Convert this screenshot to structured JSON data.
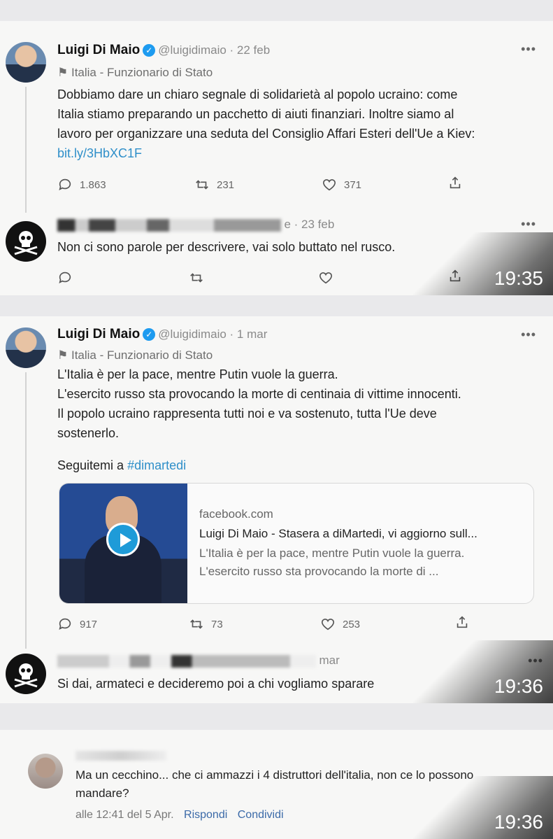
{
  "panel1": {
    "tweet": {
      "name": "Luigi Di Maio",
      "handle": "@luigidimaio · 22 feb",
      "label": "Italia - Funzionario di Stato",
      "text_lines": [
        "Dobbiamo dare un chiaro segnale di solidarietà al popolo ucraino: come",
        "Italia stiamo preparando un pacchetto di aiuti finanziari. Inoltre siamo al",
        "lavoro per organizzare una seduta del Consiglio Affari Esteri dell'Ue a Kiev:"
      ],
      "link": "bit.ly/3HbXC1F",
      "replies": "1.863",
      "retweets": "231",
      "likes": "371"
    },
    "reply": {
      "date": "e · 23 feb",
      "text": "Non ci sono parole per descrivere, vai solo buttato nel rusco."
    },
    "time": "19:35"
  },
  "panel2": {
    "tweet": {
      "name": "Luigi Di Maio",
      "handle": "@luigidimaio · 1 mar",
      "label": "Italia - Funzionario di Stato",
      "text_lines": [
        "L'Italia è per la pace, mentre Putin vuole la guerra.",
        "L'esercito russo sta provocando la morte di centinaia di vittime innocenti.",
        "Il popolo ucraino rappresenta tutti noi e va sostenuto, tutta l'Ue deve",
        "sostenerlo."
      ],
      "follow_text": "Seguitemi a ",
      "hashtag": "#dimartedi",
      "card": {
        "domain": "facebook.com",
        "title": "Luigi Di Maio - Stasera a diMartedi, vi aggiorno sull...",
        "desc_lines": [
          "L'Italia è per la pace, mentre Putin vuole la guerra.",
          "L'esercito russo sta provocando la morte di ..."
        ]
      },
      "replies": "917",
      "retweets": "73",
      "likes": "253"
    },
    "reply": {
      "date": "mar",
      "text": "Si dai, armateci e decideremo poi a chi vogliamo sparare"
    },
    "time": "19:36"
  },
  "panel3": {
    "comment": {
      "text_lines": [
        "Ma un cecchino... che ci ammazzi i 4 distruttori dell'italia, non ce lo possono",
        "mandare?"
      ],
      "timestamp": "alle 12:41 del 5 Apr.",
      "reply_label": "Rispondi",
      "share_label": "Condividi"
    },
    "time": "19:36"
  },
  "icons": [
    "verified-icon",
    "flag-icon",
    "reply-icon",
    "retweet-icon",
    "like-icon",
    "share-icon",
    "more-icon",
    "play-icon",
    "skull-icon"
  ],
  "colors": {
    "link": "#2f8fc9",
    "verified": "#1d9bf0",
    "background": "#e9e9eb",
    "panel": "#f7f7f6"
  }
}
